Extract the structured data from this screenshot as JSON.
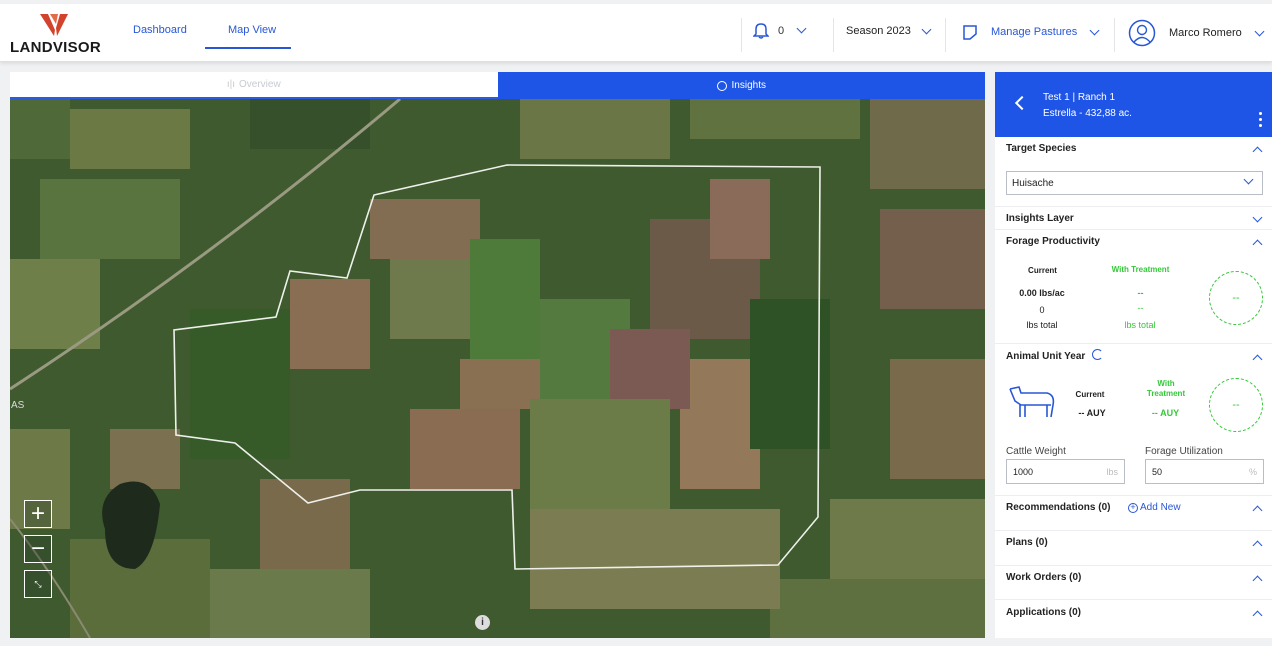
{
  "brand": {
    "name": "LANDVISOR",
    "logo_color": "#d2432d"
  },
  "nav": {
    "tabs": [
      {
        "label": "Dashboard"
      },
      {
        "label": "Map View",
        "active": true
      }
    ]
  },
  "toolbar": {
    "notifications_count": "0",
    "season": "Season 2023",
    "manage_pastures": "Manage Pastures",
    "user_name": "Marco Romero"
  },
  "map": {
    "tabs": {
      "overview": "Overview",
      "insights": "Insights"
    },
    "side_text": "AS",
    "zoom_in": "+",
    "zoom_out": "−",
    "info": "i"
  },
  "panel": {
    "header": {
      "title": "Test 1 | Ranch 1",
      "subtitle": "Estrella - 432,88 ac."
    },
    "target_species": {
      "title": "Target Species",
      "selected": "Huisache"
    },
    "insights_layer": {
      "title": "Insights Layer"
    },
    "forage": {
      "title": "Forage Productivity",
      "current_label": "Current",
      "treatment_label": "With Treatment",
      "current_rate": "0.00 lbs/ac",
      "current_total": "0",
      "current_unit": "lbs total",
      "treatment_rate": "--",
      "treatment_total": "--",
      "treatment_unit": "lbs total",
      "circle": "--"
    },
    "auy": {
      "title": "Animal Unit Year",
      "current_label": "Current",
      "current_value": "-- AUY",
      "treatment_label_1": "With",
      "treatment_label_2": "Treatment",
      "treatment_value": "-- AUY",
      "circle": "--",
      "cattle_weight_label": "Cattle Weight",
      "cattle_weight_value": "1000",
      "cattle_weight_unit": "lbs",
      "forage_util_label": "Forage Utilization",
      "forage_util_value": "50",
      "forage_util_unit": "%"
    },
    "recommendations": {
      "title": "Recommendations (0)",
      "add": "Add New"
    },
    "plans": {
      "title": "Plans (0)"
    },
    "work_orders": {
      "title": "Work Orders (0)"
    },
    "applications": {
      "title": "Applications (0)"
    }
  },
  "colors": {
    "accent": "#1f55e6",
    "green": "#35c83a"
  }
}
